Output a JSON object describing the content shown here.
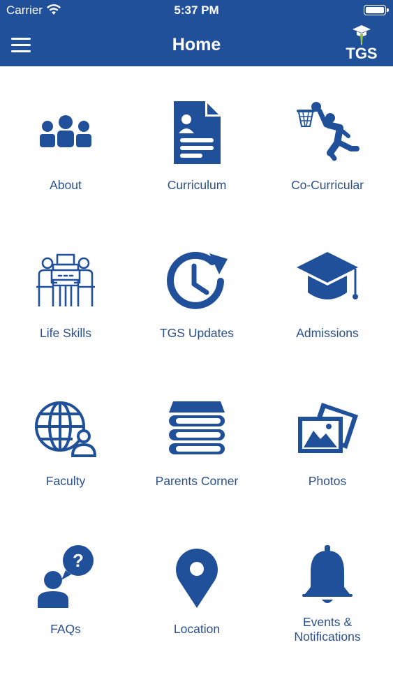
{
  "status_bar": {
    "carrier": "Carrier",
    "time": "5:37 PM"
  },
  "header": {
    "title": "Home",
    "logo_text": "TGS",
    "menu_icon": "hamburger-menu-icon"
  },
  "colors": {
    "brand": "#21509a",
    "icon": "#21509a",
    "label": "#2a4f8e",
    "logo_accent_green": "#8cc63f"
  },
  "tiles": [
    {
      "label": "About",
      "icon": "people-group-icon"
    },
    {
      "label": "Curriculum",
      "icon": "document-icon"
    },
    {
      "label": "Co-Curricular",
      "icon": "basketball-player-icon"
    },
    {
      "label": "Life Skills",
      "icon": "meeting-table-icon"
    },
    {
      "label": "TGS Updates",
      "icon": "clock-refresh-icon"
    },
    {
      "label": "Admissions",
      "icon": "graduation-cap-icon"
    },
    {
      "label": "Faculty",
      "icon": "globe-person-icon"
    },
    {
      "label": "Parents Corner",
      "icon": "book-stack-icon"
    },
    {
      "label": "Photos",
      "icon": "photos-icon"
    },
    {
      "label": "FAQs",
      "icon": "question-bubble-icon"
    },
    {
      "label": "Location",
      "icon": "location-pin-icon"
    },
    {
      "label": "Events &\nNotifications",
      "icon": "bell-icon"
    }
  ]
}
